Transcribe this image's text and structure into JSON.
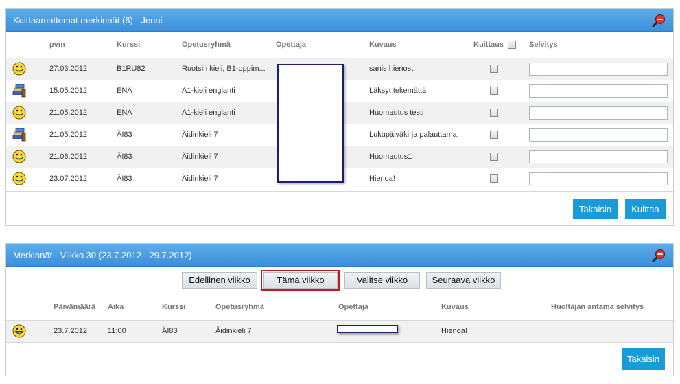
{
  "panel1": {
    "title": "Kuittaamattomat merkinnät (6) - Jenni",
    "columns": {
      "pvm": "pvm",
      "kurssi": "Kurssi",
      "opetusryhma": "Opetusryhmä",
      "opettaja": "Opettaja",
      "kuvaus": "Kuvaus",
      "kuittaus": "Kuittaus",
      "selvitys": "Selvitys"
    },
    "rows": [
      {
        "icon": "smiley-icon",
        "pvm": "27.03.2012",
        "kurssi": "B1RU82",
        "ryhma": "Ruotsin kieli, B1-oppim...",
        "kuvaus": "sanis hienosti"
      },
      {
        "icon": "books-icon",
        "pvm": "15.05.2012",
        "kurssi": "ENA",
        "ryhma": "A1-kieli englanti",
        "kuvaus": "Läksyt tekemättä"
      },
      {
        "icon": "smiley-icon",
        "pvm": "21.05.2012",
        "kurssi": "ENA",
        "ryhma": "A1-kieli englanti",
        "kuvaus": "Huomautus testi"
      },
      {
        "icon": "books-icon",
        "pvm": "21.05.2012",
        "kurssi": "ÄI83",
        "ryhma": "Äidinkieli 7",
        "kuvaus": "Lukupäiväkirja palauttama..."
      },
      {
        "icon": "smiley-icon",
        "pvm": "21.06.2012",
        "kurssi": "ÄI83",
        "ryhma": "Äidinkieli 7",
        "kuvaus": "Huomautus1"
      },
      {
        "icon": "smiley-icon",
        "pvm": "23.07.2012",
        "kurssi": "ÄI83",
        "ryhma": "Äidinkieli 7",
        "kuvaus": "Hienoa!"
      }
    ],
    "back_label": "Takaisin",
    "ack_label": "Kuittaa"
  },
  "panel2": {
    "title": "Merkinnät - Viikko 30 (23.7.2012 - 29.7.2012)",
    "nav": {
      "prev": "Edellinen viikko",
      "current": "Tämä viikko",
      "choose": "Valitse viikko",
      "next": "Seuraava viikko"
    },
    "columns": {
      "paivamaara": "Päivämäärä",
      "aika": "Aika",
      "kurssi": "Kurssi",
      "opetusryhma": "Opetusryhmä",
      "opettaja": "Opettaja",
      "kuvaus": "Kuvaus",
      "selvitys": "Huoltajan antama selvitys"
    },
    "rows": [
      {
        "icon": "smiley-icon",
        "paivamaara": "23.7.2012",
        "aika": "11:00",
        "kurssi": "ÄI83",
        "ryhma": "Äidinkieli 7",
        "kuvaus": "Hienoa!"
      }
    ],
    "back_label": "Takaisin"
  },
  "colors": {
    "header_top": "#5dadea",
    "header_bottom": "#3b8fdb",
    "button_blue": "#1a9ad8",
    "highlight_red": "#c01a1a"
  }
}
